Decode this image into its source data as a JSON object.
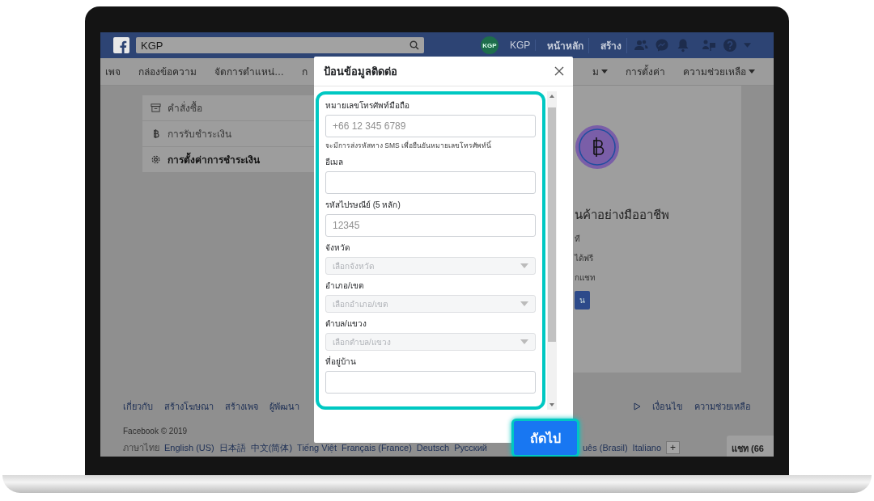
{
  "top_bar": {
    "search": {
      "value": "KGP"
    },
    "profile": {
      "avatar": "KGP",
      "name": "KGP"
    },
    "links": [
      "หน้าหลัก",
      "สร้าง"
    ]
  },
  "nav": {
    "items": [
      {
        "label": "เพจ",
        "has_menu": false
      },
      {
        "label": "กล่องข้อความ",
        "has_menu": false
      },
      {
        "label": "จัดการตำแหน่…",
        "has_menu": false
      },
      {
        "label": "ก",
        "has_menu": false
      },
      {
        "label": "ม",
        "has_menu": true
      },
      {
        "label": "การตั้งค่า",
        "has_menu": false
      },
      {
        "label": "ความช่วยเหลือ",
        "has_menu": true
      }
    ]
  },
  "sidebar": {
    "items": [
      {
        "kind": "box",
        "label": "คำสั่งซื้อ",
        "selected": false
      },
      {
        "kind": "baht",
        "label": "การรับชำระเงิน",
        "selected": false
      },
      {
        "kind": "gear",
        "label": "การตั้งค่าการชำระเงิน",
        "selected": true
      }
    ]
  },
  "promo": {
    "title": "นค้าอย่างมืออาชีพ",
    "lines": [
      "ที",
      "ได้ฟรี",
      "กแชท"
    ],
    "button": "น"
  },
  "dialog": {
    "title": "ป้อนข้อมูลติดต่อ",
    "fields": [
      {
        "kind": "text",
        "label": "หมายเลขโทรศัพท์มือถือ",
        "placeholder": "+66 12 345 6789",
        "hint": "จะมีการส่งรหัสทาง SMS เพื่อยืนยันหมายเลขโทรศัพท์นี้"
      },
      {
        "kind": "text",
        "label": "อีเมล"
      },
      {
        "kind": "text",
        "label": "รหัสไปรษณีย์ (5 หลัก)",
        "placeholder": "12345"
      },
      {
        "kind": "select",
        "label": "จังหวัด",
        "placeholder": "เลือกจังหวัด",
        "disabled": true
      },
      {
        "kind": "select",
        "label": "อำเภอ/เขต",
        "placeholder": "เลือกอำเภอ/เขต",
        "disabled": true
      },
      {
        "kind": "select",
        "label": "ตำบล/แขวง",
        "placeholder": "เลือกตำบล/แขวง",
        "disabled": true
      },
      {
        "kind": "text",
        "label": "ที่อยู่บ้าน"
      }
    ],
    "next_button": "ถัดไป"
  },
  "footer": {
    "links_left": [
      "เกี่ยวกับ",
      "สร้างโฆษณา",
      "สร้างเพจ",
      "ผู้พัฒนา"
    ],
    "links_right": [
      "เงื่อนไข",
      "ความช่วยเหลือ"
    ],
    "copyright": "Facebook © 2019",
    "languages_left": [
      {
        "label": "ภาษาไทย",
        "selected": true
      },
      {
        "label": "English (US)",
        "selected": false
      },
      {
        "label": "日本語",
        "selected": false
      },
      {
        "label": "中文(简体)",
        "selected": false
      },
      {
        "label": "Tiếng Việt",
        "selected": false
      },
      {
        "label": "Français (France)",
        "selected": false
      },
      {
        "label": "Deutsch",
        "selected": false
      },
      {
        "label": "Русский",
        "selected": false
      }
    ],
    "languages_right": [
      {
        "label": "uês (Brasil)",
        "selected": false
      },
      {
        "label": "Italiano",
        "selected": false
      }
    ],
    "more_button": "+"
  },
  "chat": {
    "label": "แชท (66"
  }
}
